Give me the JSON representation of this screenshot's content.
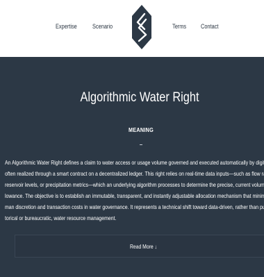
{
  "nav": {
    "expertise": "Expertise",
    "scenario": "Scenario",
    "terms": "Terms",
    "contact": "Contact"
  },
  "logo_icon": "hexagon-s-logo-icon",
  "main": {
    "title": "Algorithmic Water Right",
    "subtitle": "MEANING",
    "divider_glyph": "–",
    "paragraph_lines": [
      "An Algorithmic Water Right defines a claim to water access or usage volume governed and executed automatically by digital logic,",
      "often realized through a smart contract on a decentralized ledger. This right relies on real-time data inputs—such as flow rates,",
      "reservoir levels, or precipitation metrics—which an underlying algorithm processes to determine the precise, current volumetric al-",
      "lowance. The objective is to establish an immutable, transparent, and instantly adjustable allocation mechanism that minimizes hu-",
      "man discretion and transaction costs in water governance. It represents a technical shift toward data-driven, rather than purely his-",
      "torical or bureaucratic, water resource management."
    ],
    "read_more": "Read More ↓"
  },
  "colors": {
    "header_bg": "#ffffff",
    "main_bg": "#2c3845",
    "nav_text": "#2b3642",
    "logo_dark": "#2c3845"
  }
}
